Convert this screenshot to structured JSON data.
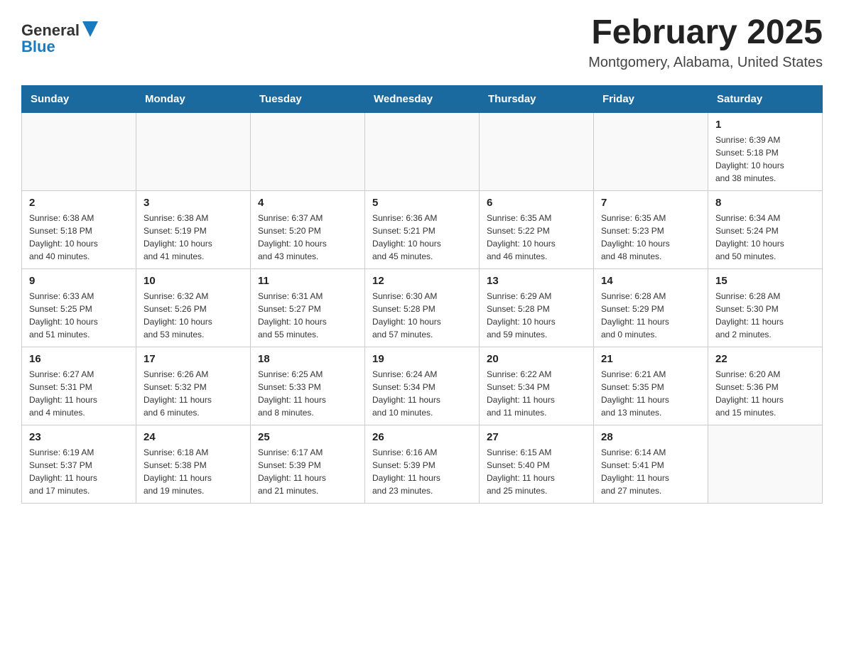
{
  "header": {
    "logo_general": "General",
    "logo_blue": "Blue",
    "title": "February 2025",
    "subtitle": "Montgomery, Alabama, United States"
  },
  "days_of_week": [
    "Sunday",
    "Monday",
    "Tuesday",
    "Wednesday",
    "Thursday",
    "Friday",
    "Saturday"
  ],
  "weeks": [
    [
      {
        "day": "",
        "info": ""
      },
      {
        "day": "",
        "info": ""
      },
      {
        "day": "",
        "info": ""
      },
      {
        "day": "",
        "info": ""
      },
      {
        "day": "",
        "info": ""
      },
      {
        "day": "",
        "info": ""
      },
      {
        "day": "1",
        "info": "Sunrise: 6:39 AM\nSunset: 5:18 PM\nDaylight: 10 hours\nand 38 minutes."
      }
    ],
    [
      {
        "day": "2",
        "info": "Sunrise: 6:38 AM\nSunset: 5:18 PM\nDaylight: 10 hours\nand 40 minutes."
      },
      {
        "day": "3",
        "info": "Sunrise: 6:38 AM\nSunset: 5:19 PM\nDaylight: 10 hours\nand 41 minutes."
      },
      {
        "day": "4",
        "info": "Sunrise: 6:37 AM\nSunset: 5:20 PM\nDaylight: 10 hours\nand 43 minutes."
      },
      {
        "day": "5",
        "info": "Sunrise: 6:36 AM\nSunset: 5:21 PM\nDaylight: 10 hours\nand 45 minutes."
      },
      {
        "day": "6",
        "info": "Sunrise: 6:35 AM\nSunset: 5:22 PM\nDaylight: 10 hours\nand 46 minutes."
      },
      {
        "day": "7",
        "info": "Sunrise: 6:35 AM\nSunset: 5:23 PM\nDaylight: 10 hours\nand 48 minutes."
      },
      {
        "day": "8",
        "info": "Sunrise: 6:34 AM\nSunset: 5:24 PM\nDaylight: 10 hours\nand 50 minutes."
      }
    ],
    [
      {
        "day": "9",
        "info": "Sunrise: 6:33 AM\nSunset: 5:25 PM\nDaylight: 10 hours\nand 51 minutes."
      },
      {
        "day": "10",
        "info": "Sunrise: 6:32 AM\nSunset: 5:26 PM\nDaylight: 10 hours\nand 53 minutes."
      },
      {
        "day": "11",
        "info": "Sunrise: 6:31 AM\nSunset: 5:27 PM\nDaylight: 10 hours\nand 55 minutes."
      },
      {
        "day": "12",
        "info": "Sunrise: 6:30 AM\nSunset: 5:28 PM\nDaylight: 10 hours\nand 57 minutes."
      },
      {
        "day": "13",
        "info": "Sunrise: 6:29 AM\nSunset: 5:28 PM\nDaylight: 10 hours\nand 59 minutes."
      },
      {
        "day": "14",
        "info": "Sunrise: 6:28 AM\nSunset: 5:29 PM\nDaylight: 11 hours\nand 0 minutes."
      },
      {
        "day": "15",
        "info": "Sunrise: 6:28 AM\nSunset: 5:30 PM\nDaylight: 11 hours\nand 2 minutes."
      }
    ],
    [
      {
        "day": "16",
        "info": "Sunrise: 6:27 AM\nSunset: 5:31 PM\nDaylight: 11 hours\nand 4 minutes."
      },
      {
        "day": "17",
        "info": "Sunrise: 6:26 AM\nSunset: 5:32 PM\nDaylight: 11 hours\nand 6 minutes."
      },
      {
        "day": "18",
        "info": "Sunrise: 6:25 AM\nSunset: 5:33 PM\nDaylight: 11 hours\nand 8 minutes."
      },
      {
        "day": "19",
        "info": "Sunrise: 6:24 AM\nSunset: 5:34 PM\nDaylight: 11 hours\nand 10 minutes."
      },
      {
        "day": "20",
        "info": "Sunrise: 6:22 AM\nSunset: 5:34 PM\nDaylight: 11 hours\nand 11 minutes."
      },
      {
        "day": "21",
        "info": "Sunrise: 6:21 AM\nSunset: 5:35 PM\nDaylight: 11 hours\nand 13 minutes."
      },
      {
        "day": "22",
        "info": "Sunrise: 6:20 AM\nSunset: 5:36 PM\nDaylight: 11 hours\nand 15 minutes."
      }
    ],
    [
      {
        "day": "23",
        "info": "Sunrise: 6:19 AM\nSunset: 5:37 PM\nDaylight: 11 hours\nand 17 minutes."
      },
      {
        "day": "24",
        "info": "Sunrise: 6:18 AM\nSunset: 5:38 PM\nDaylight: 11 hours\nand 19 minutes."
      },
      {
        "day": "25",
        "info": "Sunrise: 6:17 AM\nSunset: 5:39 PM\nDaylight: 11 hours\nand 21 minutes."
      },
      {
        "day": "26",
        "info": "Sunrise: 6:16 AM\nSunset: 5:39 PM\nDaylight: 11 hours\nand 23 minutes."
      },
      {
        "day": "27",
        "info": "Sunrise: 6:15 AM\nSunset: 5:40 PM\nDaylight: 11 hours\nand 25 minutes."
      },
      {
        "day": "28",
        "info": "Sunrise: 6:14 AM\nSunset: 5:41 PM\nDaylight: 11 hours\nand 27 minutes."
      },
      {
        "day": "",
        "info": ""
      }
    ]
  ]
}
